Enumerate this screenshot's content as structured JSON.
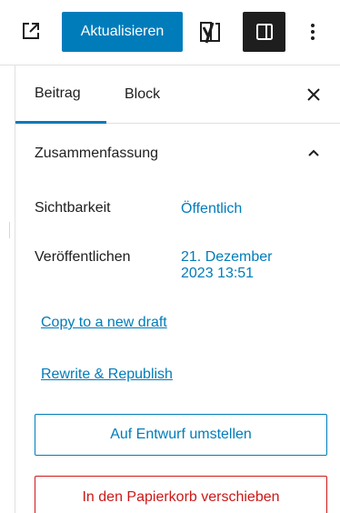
{
  "toolbar": {
    "external_link_icon": "external-link-icon",
    "update_label": "Aktualisieren",
    "yoast_icon": "yoast-y-icon",
    "sidebar_toggle_icon": "sidebar-panel-icon",
    "more_icon": "vertical-ellipsis-icon"
  },
  "tabs": [
    {
      "label": "Beitrag",
      "active": true
    },
    {
      "label": "Block",
      "active": false
    }
  ],
  "close_icon": "close-icon",
  "section": {
    "title": "Zusammenfassung",
    "expanded_icon": "chevron-up-icon"
  },
  "rows": {
    "visibility": {
      "label": "Sichtbarkeit",
      "value": "Öffentlich"
    },
    "publish": {
      "label": "Veröffentlichen",
      "value_line1": "21. Dezember",
      "value_line2": "2023 13:51"
    }
  },
  "links": {
    "copy_draft": "Copy to a new draft",
    "rewrite": "Rewrite & Republish"
  },
  "buttons": {
    "switch_draft": "Auf Entwurf umstellen",
    "trash": "In den Papierkorb verschieben"
  },
  "colors": {
    "accent": "#007cba",
    "danger": "#cc1818",
    "dark": "#1e1e1e"
  }
}
